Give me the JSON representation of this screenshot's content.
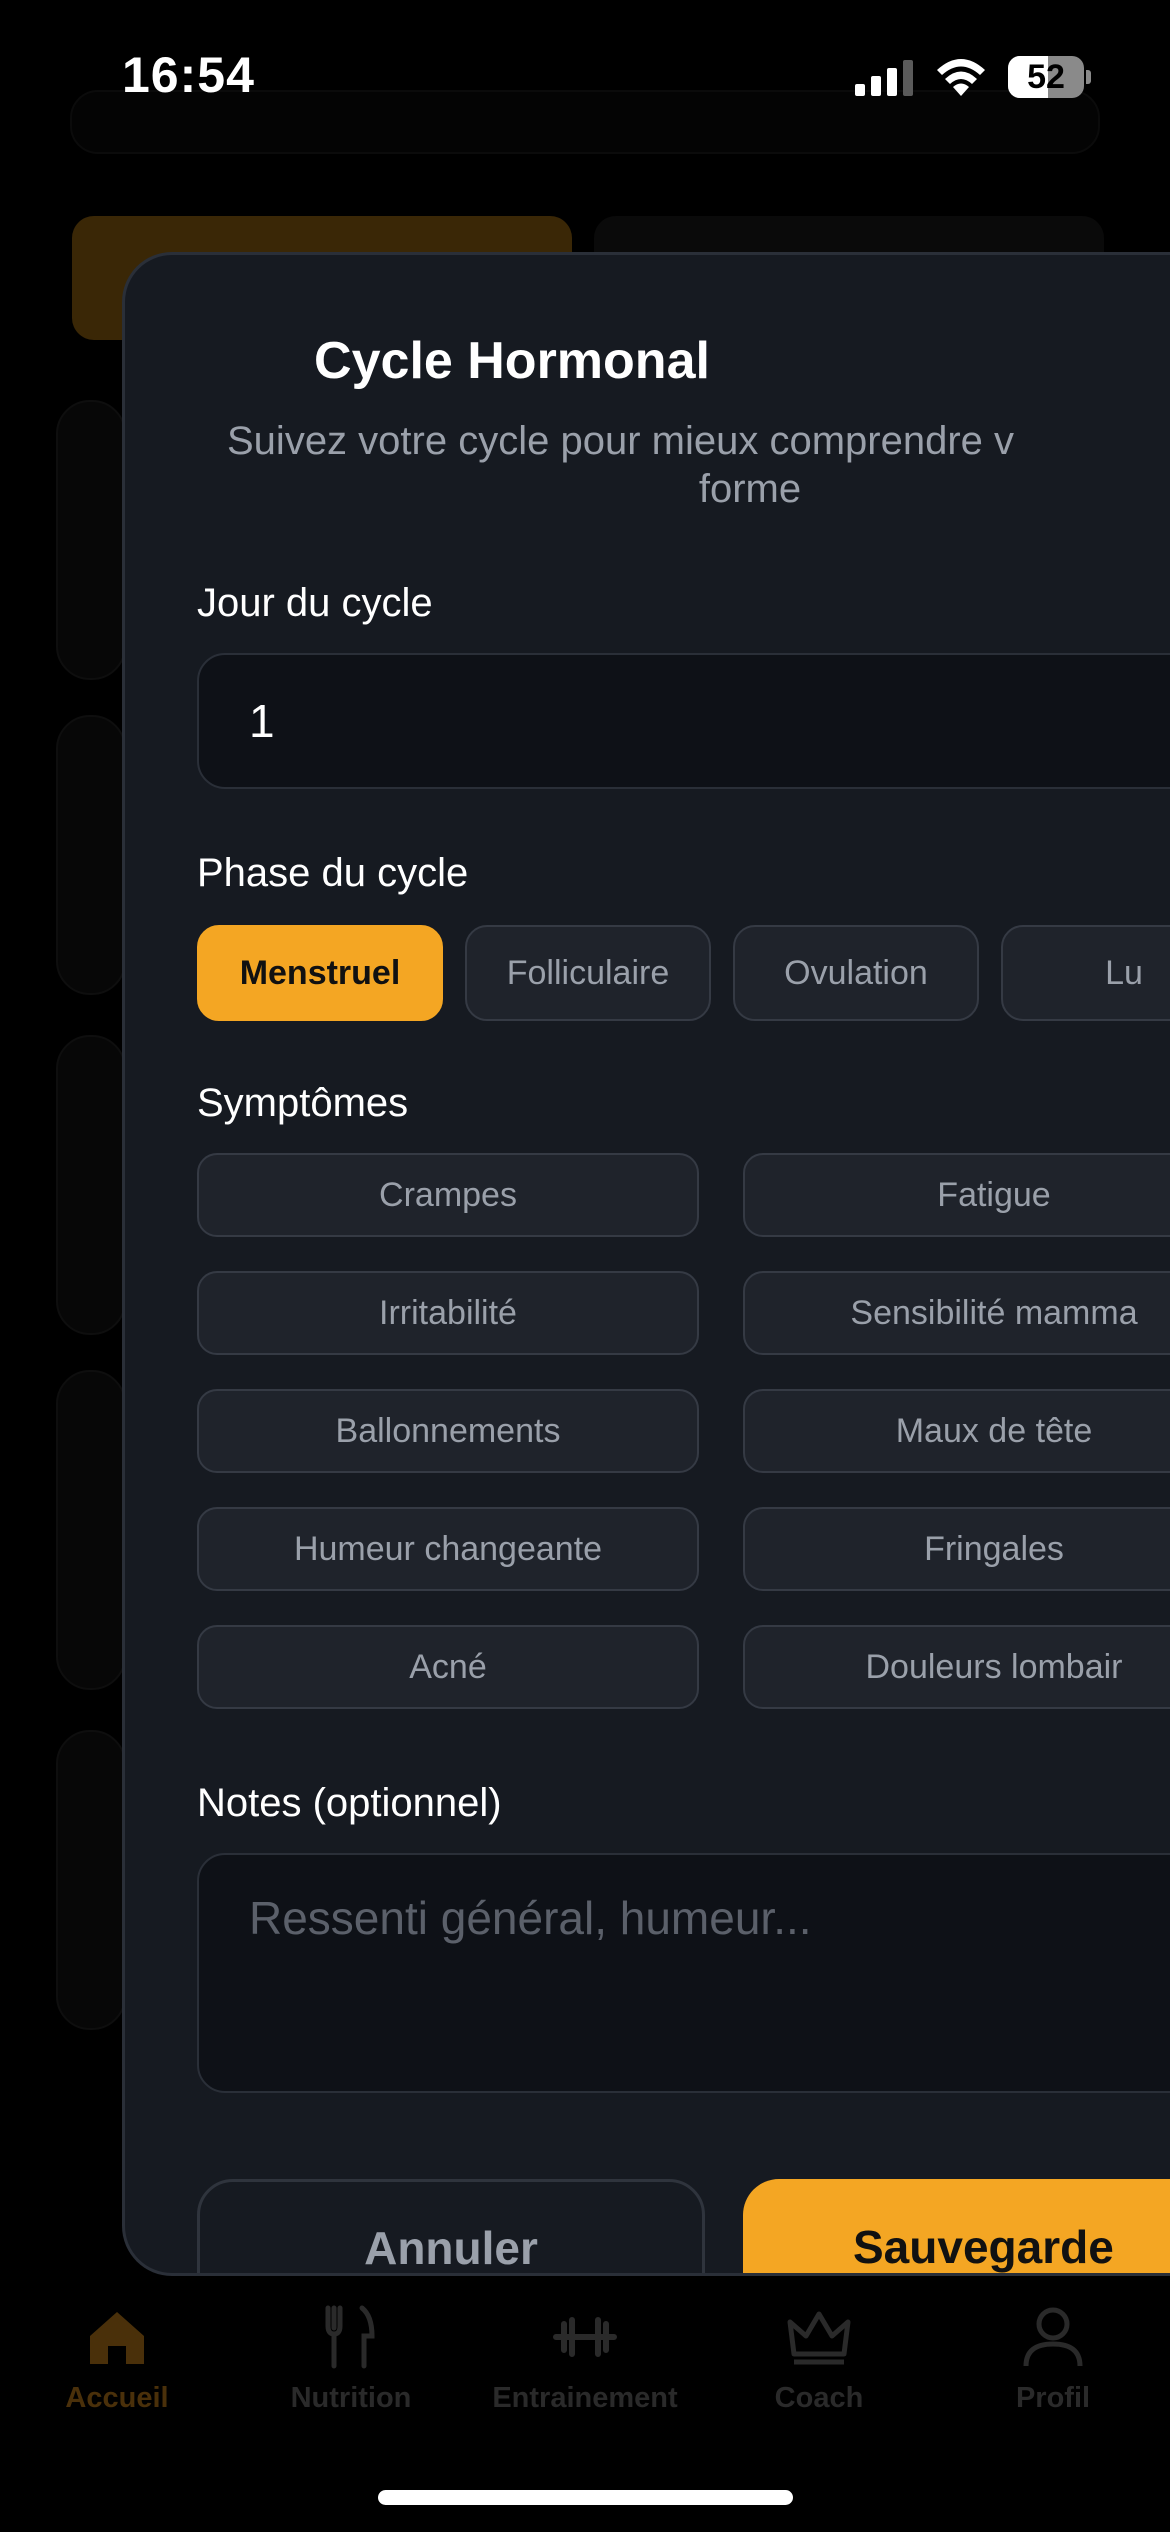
{
  "status_bar": {
    "time": "16:54",
    "battery_percent": 52,
    "battery_label": "52"
  },
  "background": {
    "tabs": [
      {
        "label": "Accueil",
        "icon": "home-icon",
        "active": true
      },
      {
        "label": "Nutrition",
        "icon": "fork-knife-icon",
        "active": false
      },
      {
        "label": "Entrainement",
        "icon": "dumbbell-icon",
        "active": false
      },
      {
        "label": "Coach",
        "icon": "crown-icon",
        "active": false
      },
      {
        "label": "Profil",
        "icon": "person-icon",
        "active": false
      }
    ]
  },
  "sheet": {
    "title": "Cycle Hormonal",
    "subtitle_line1": "Suivez votre cycle pour mieux comprendre v",
    "subtitle_line2": "forme",
    "day_label": "Jour du cycle",
    "day_value": "1",
    "phase_label": "Phase du cycle",
    "phases": [
      {
        "label": "Menstruel",
        "selected": true
      },
      {
        "label": "Folliculaire",
        "selected": false
      },
      {
        "label": "Ovulation",
        "selected": false
      },
      {
        "label": "Lu",
        "selected": false
      }
    ],
    "symptoms_label": "Symptômes",
    "symptoms": [
      "Crampes",
      "Fatigue",
      "Irritabilité",
      "Sensibilité mamma",
      "Ballonnements",
      "Maux de tête",
      "Humeur changeante",
      "Fringales",
      "Acné",
      "Douleurs lombair"
    ],
    "notes_label": "Notes (optionnel)",
    "notes_placeholder": "Ressenti général, humeur...",
    "cancel_label": "Annuler",
    "save_label": "Sauvegarde"
  },
  "colors": {
    "accent": "#f4a623",
    "sheet_bg": "#161a21",
    "chip_bg": "#1f232b",
    "muted_text": "#9aa0aa"
  }
}
